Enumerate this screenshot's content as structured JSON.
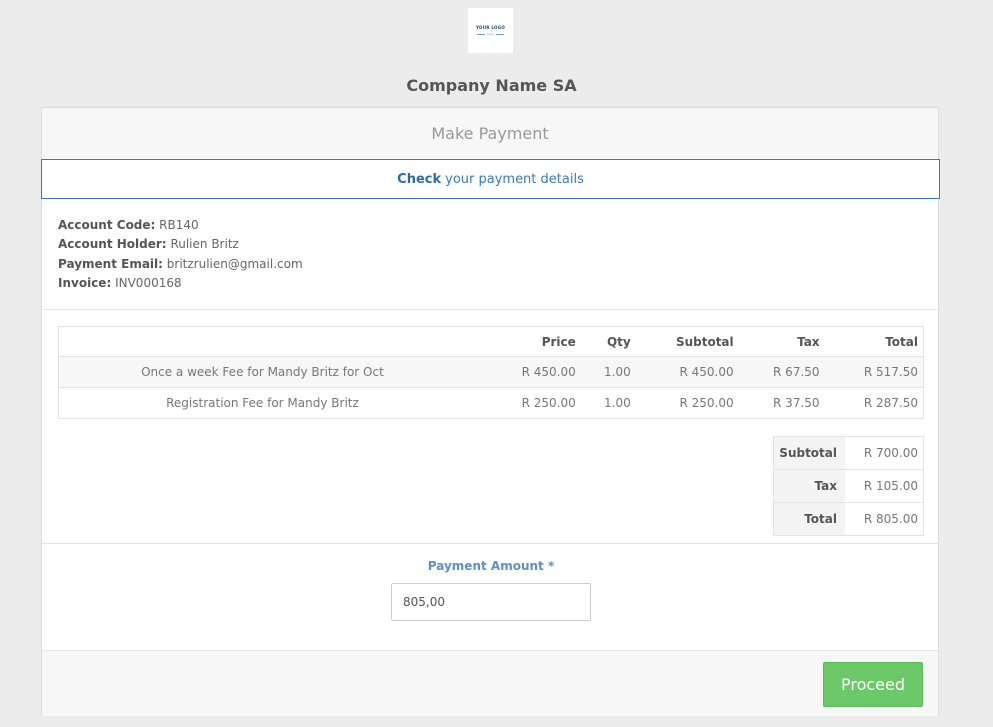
{
  "company": {
    "name": "Company Name SA",
    "logo_text": "YOUR LOGO",
    "logo_sub": "here"
  },
  "card": {
    "header": "Make Payment",
    "alert_strong": "Check",
    "alert_text": "your payment details"
  },
  "account": {
    "code_label": "Account Code:",
    "code": "RB140",
    "holder_label": "Account Holder:",
    "holder": "Rulien Britz",
    "email_label": "Payment Email:",
    "email": "britzrulien@gmail.com",
    "invoice_label": "Invoice:",
    "invoice": "INV000168"
  },
  "items": {
    "headers": [
      "",
      "Price",
      "Qty",
      "Subtotal",
      "Tax",
      "Total"
    ],
    "rows": [
      [
        "Once a week Fee for Mandy Britz for Oct",
        "R 450.00",
        "1.00",
        "R 450.00",
        "R 67.50",
        "R 517.50"
      ],
      [
        "Registration Fee for Mandy Britz",
        "R 250.00",
        "1.00",
        "R 250.00",
        "R 37.50",
        "R 287.50"
      ]
    ]
  },
  "totals": {
    "subtotal_label": "Subtotal",
    "subtotal": "R 700.00",
    "tax_label": "Tax",
    "tax": "R 105.00",
    "total_label": "Total",
    "total": "R 805.00"
  },
  "payment": {
    "label": "Payment Amount *",
    "value": "805,00"
  },
  "footer": {
    "proceed_label": "Proceed"
  },
  "colors": {
    "primary": "#3a78c0",
    "success": "#6cc96a",
    "background": "#ececec"
  }
}
